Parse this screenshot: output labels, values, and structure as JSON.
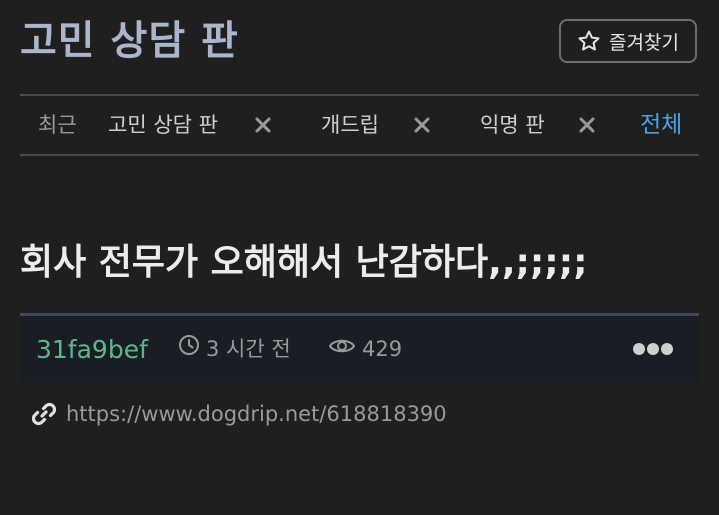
{
  "header": {
    "board_title": "고민 상담 판",
    "favorite_label": "즐겨찾기"
  },
  "recent": {
    "label": "최근",
    "items": [
      "고민 상담 판",
      "개드립",
      "익명 판"
    ],
    "all_label": "전체"
  },
  "post": {
    "title": "회사 전무가 오해해서 난감하다,,;;;;;",
    "author": "31fa9bef",
    "time": "3 시간 전",
    "views": "429",
    "url": "https://www.dogdrip.net/618818390"
  },
  "colors": {
    "background": "#1f1f1f",
    "title_blue": "#a9b6cc",
    "author_green": "#5cb88a",
    "link_blue": "#4da3e0"
  },
  "icons": [
    "star-icon",
    "close-icon",
    "clock-icon",
    "eye-icon",
    "more-icon",
    "link-icon"
  ]
}
